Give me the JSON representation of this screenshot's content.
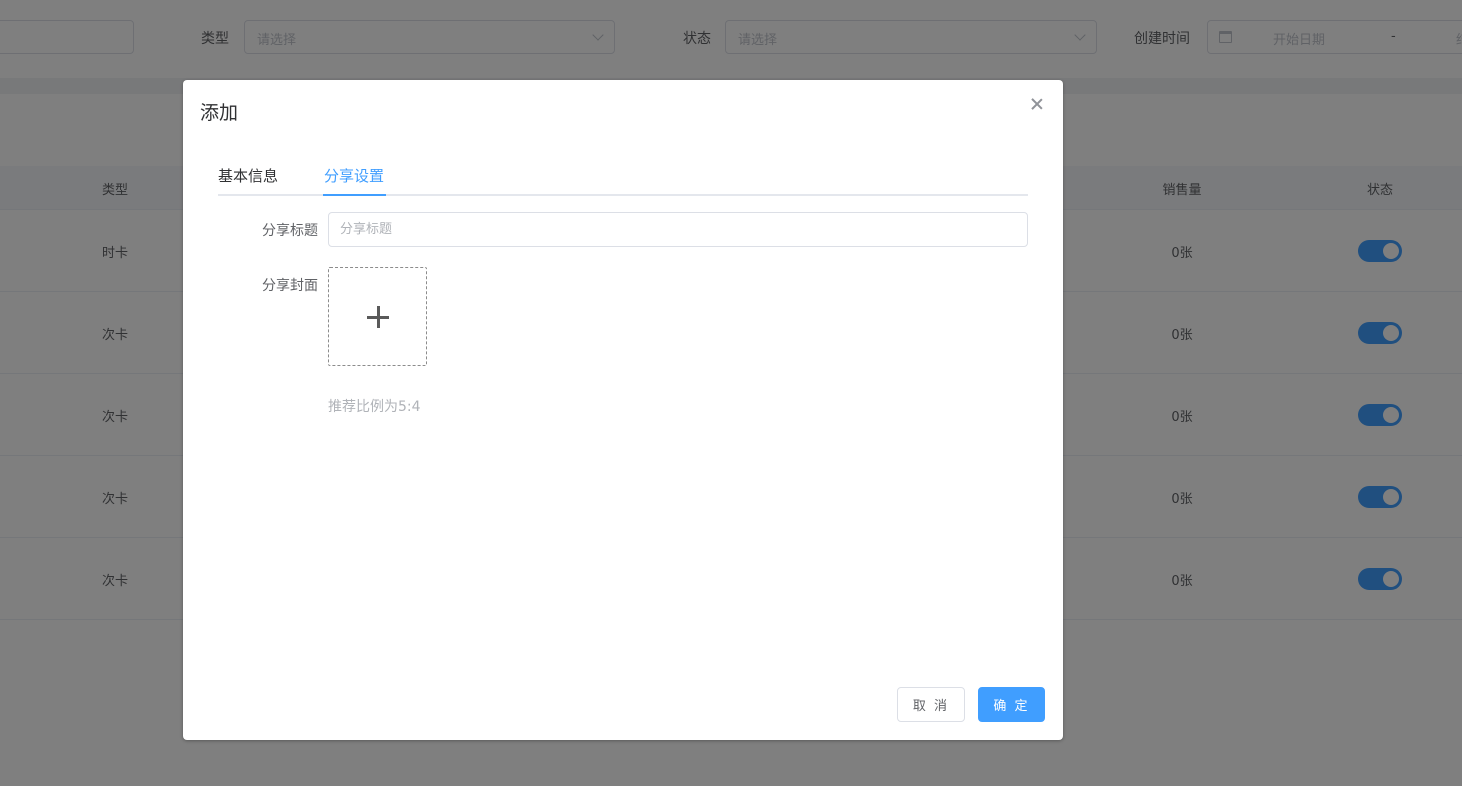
{
  "background": {
    "filters": {
      "type_label": "类型",
      "type_placeholder": "请选择",
      "status_label": "状态",
      "status_placeholder": "请选择",
      "created_label": "创建时间",
      "start_date_placeholder": "开始日期",
      "range_separator": "-",
      "end_date_partial": "结"
    },
    "table": {
      "columns": [
        "类型",
        "销售量",
        "状态"
      ],
      "rows": [
        {
          "type": "时卡",
          "sales": "0张",
          "enabled": true
        },
        {
          "type": "次卡",
          "sales": "0张",
          "enabled": true
        },
        {
          "type": "次卡",
          "sales": "0张",
          "enabled": true
        },
        {
          "type": "次卡",
          "sales": "0张",
          "enabled": true
        },
        {
          "type": "次卡",
          "sales": "0张",
          "enabled": true
        }
      ]
    }
  },
  "dialog": {
    "title": "添加",
    "tabs": [
      {
        "label": "基本信息",
        "active": false
      },
      {
        "label": "分享设置",
        "active": true
      }
    ],
    "form": {
      "share_title_label": "分享标题",
      "share_title_placeholder": "分享标题",
      "share_title_value": "",
      "share_cover_label": "分享封面",
      "upload_hint": "推荐比例为5:4"
    },
    "buttons": {
      "cancel": "取 消",
      "confirm": "确 定"
    }
  },
  "colors": {
    "primary": "#409eff",
    "overlay": "rgba(0,0,0,0.5)"
  }
}
